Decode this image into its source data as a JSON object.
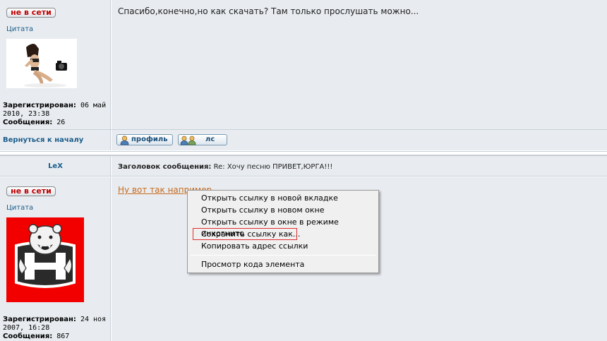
{
  "post1": {
    "status_label": "не в сети",
    "rank": "Цитата",
    "registered_label": "Зарегистрирован:",
    "registered_value": "06 май 2010, 23:38",
    "messages_label": "Сообщения:",
    "messages_value": "26",
    "text": "Спасибо,конечно,но как скачать? Там только прослушать можно..."
  },
  "nav": {
    "back_to_top": "Вернуться к началу",
    "profile_label": "профиль",
    "pm_label": "лс"
  },
  "post2": {
    "author": "LeX",
    "subject_label": "Заголовок сообщения:",
    "subject_value": "Re: Хочу песню ПРИВЕТ,ЮРГА!!!",
    "status_label": "не в сети",
    "rank": "Цитата",
    "registered_label": "Зарегистрирован:",
    "registered_value": "24 ноя 2007, 16:28",
    "messages_label": "Сообщения:",
    "messages_value": "867",
    "link_text": "Ну вот так например"
  },
  "context_menu": {
    "items": [
      "Открыть ссылку в новой вкладке",
      "Открыть ссылку в новом окне",
      "Открыть ссылку в окне в режиме инкогнито",
      "Сохранить ссылку как...",
      "Копировать адрес ссылки",
      "Просмотр кода элемента"
    ],
    "highlight_color": "#e03030"
  },
  "colors": {
    "panel_bg": "#e8ecf0",
    "status_text": "#c00000",
    "link_blue": "#1a5b8a",
    "link_orange": "#c76a1d",
    "avatar_red": "#f20000"
  },
  "icons": [
    "profile-icon",
    "pm-icon",
    "girl-camera-avatar",
    "bear-logo-avatar"
  ]
}
